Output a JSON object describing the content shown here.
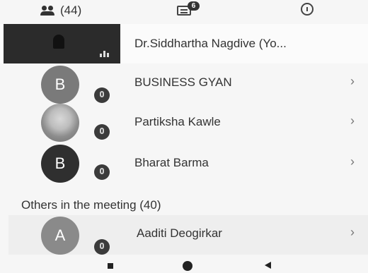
{
  "tabs": {
    "people_label": "(44)",
    "chat_badge": "6"
  },
  "self": {
    "name": "Dr.Siddhartha Nagdive (Yo..."
  },
  "participants": [
    {
      "initial": "B",
      "name": "BUSINESS GYAN",
      "avatar_color": "#7a7a7a"
    },
    {
      "initial": "",
      "name": "Partiksha Kawle",
      "avatar_color": "#9a9a9a"
    },
    {
      "initial": "B",
      "name": "Bharat Barma",
      "avatar_color": "#2f2f2f"
    }
  ],
  "others": {
    "heading": "Others in the meeting (40)",
    "items": [
      {
        "initial": "A",
        "name": "Aaditi Deogirkar",
        "avatar_color": "#8a8a8a"
      }
    ]
  },
  "chevron": "›"
}
